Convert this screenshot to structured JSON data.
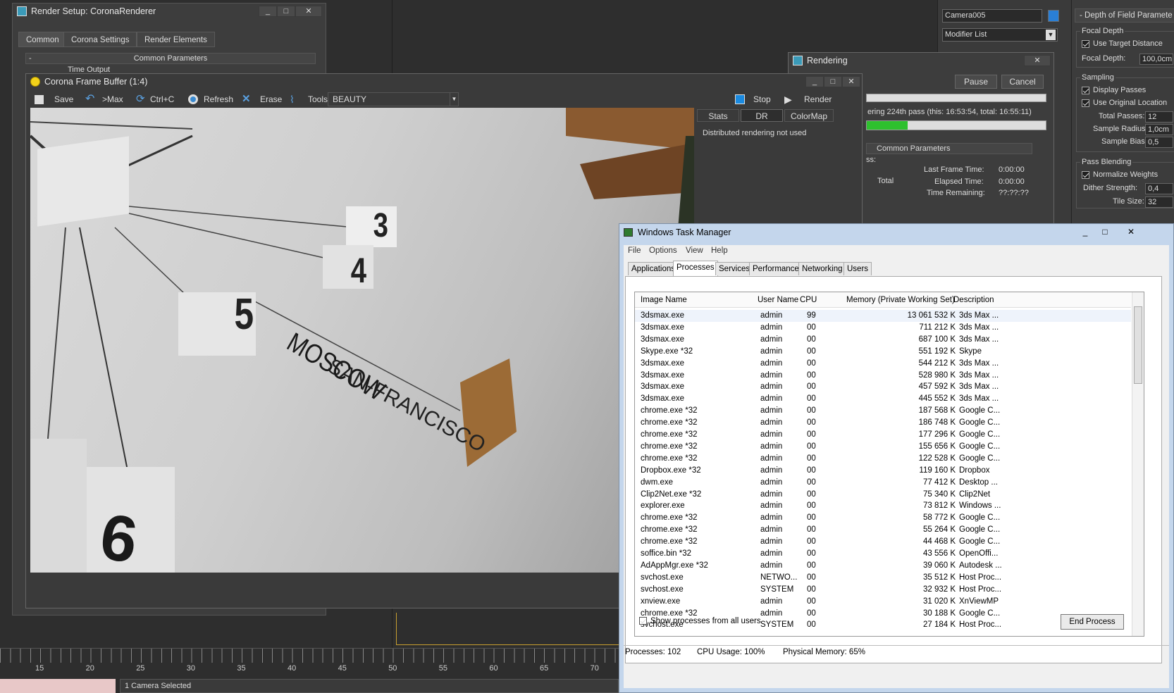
{
  "render_setup": {
    "title": "Render Setup: CoronaRenderer",
    "tabs": [
      "Common",
      "Corona Settings",
      "Render Elements"
    ],
    "rollout": "Common Parameters",
    "group": "Time Output"
  },
  "frame_buffer": {
    "title": "Corona Frame Buffer (1:4)",
    "toolbar": {
      "save": "Save",
      "max": ">Max",
      "copy": "Ctrl+C",
      "refresh": "Refresh",
      "erase": "Erase",
      "tools": "Tools",
      "pass": "BEAUTY",
      "stop": "Stop",
      "render": "Render"
    },
    "side_tabs": [
      "Stats",
      "DR",
      "ColorMap"
    ],
    "side_msg": "Distributed rendering not used",
    "image_text": {
      "n3": "3",
      "n4": "4",
      "n5": "5",
      "n6": "6",
      "city1": "SAN-FRANCISCO",
      "city2": "MOSCOW"
    }
  },
  "rendering": {
    "title": "Rendering",
    "pause": "Pause",
    "cancel": "Cancel",
    "status": "ering 224th pass (this: 16:53:54, total: 16:55:11)",
    "progress": 0.23,
    "rollout": "Common Parameters",
    "label_ss": "ss:",
    "label_total": "Total",
    "last_frame_label": "Last Frame Time:",
    "last_frame_value": "0:00:00",
    "elapsed_label": "Elapsed Time:",
    "elapsed_value": "0:00:00",
    "remaining_label": "Time Remaining:",
    "remaining_value": "??:??:??"
  },
  "modify_panel": {
    "object_name": "Camera005",
    "modifier_list": "Modifier List",
    "object_color": "#2a7fd6"
  },
  "dof": {
    "title": "Depth of Field Paramete",
    "focal_depth_group": "Focal Depth",
    "use_target": "Use Target Distance",
    "focal_depth_label": "Focal Depth:",
    "focal_depth_value": "100,0cm",
    "sampling_group": "Sampling",
    "display_passes": "Display Passes",
    "use_original": "Use Original Location",
    "total_passes_label": "Total Passes:",
    "total_passes_value": "12",
    "sample_radius_label": "Sample Radius:",
    "sample_radius_value": "1,0cm",
    "sample_bias_label": "Sample Bias:",
    "sample_bias_value": "0,5",
    "pass_blending_group": "Pass Blending",
    "normalize": "Normalize Weights",
    "dither_label": "Dither Strength:",
    "dither_value": "0,4",
    "tile_label": "Tile Size:",
    "tile_value": "32"
  },
  "timeline": {
    "ticks": [
      "15",
      "20",
      "25",
      "30",
      "35",
      "40",
      "45",
      "50",
      "55",
      "60",
      "65",
      "70"
    ],
    "status": "1 Camera Selected"
  },
  "task_manager": {
    "title": "Windows Task Manager",
    "menu": [
      "File",
      "Options",
      "View",
      "Help"
    ],
    "tabs": [
      "Applications",
      "Processes",
      "Services",
      "Performance",
      "Networking",
      "Users"
    ],
    "columns": [
      "Image Name",
      "User Name",
      "CPU",
      "Memory (Private Working Set)",
      "Description"
    ],
    "rows": [
      {
        "name": "3dsmax.exe",
        "user": "admin",
        "cpu": "99",
        "mem": "13 061 532 K",
        "desc": "3ds Max ..."
      },
      {
        "name": "3dsmax.exe",
        "user": "admin",
        "cpu": "00",
        "mem": "711 212 K",
        "desc": "3ds Max ..."
      },
      {
        "name": "3dsmax.exe",
        "user": "admin",
        "cpu": "00",
        "mem": "687 100 K",
        "desc": "3ds Max ..."
      },
      {
        "name": "Skype.exe *32",
        "user": "admin",
        "cpu": "00",
        "mem": "551 192 K",
        "desc": "Skype"
      },
      {
        "name": "3dsmax.exe",
        "user": "admin",
        "cpu": "00",
        "mem": "544 212 K",
        "desc": "3ds Max ..."
      },
      {
        "name": "3dsmax.exe",
        "user": "admin",
        "cpu": "00",
        "mem": "528 980 K",
        "desc": "3ds Max ..."
      },
      {
        "name": "3dsmax.exe",
        "user": "admin",
        "cpu": "00",
        "mem": "457 592 K",
        "desc": "3ds Max ..."
      },
      {
        "name": "3dsmax.exe",
        "user": "admin",
        "cpu": "00",
        "mem": "445 552 K",
        "desc": "3ds Max ..."
      },
      {
        "name": "chrome.exe *32",
        "user": "admin",
        "cpu": "00",
        "mem": "187 568 K",
        "desc": "Google C..."
      },
      {
        "name": "chrome.exe *32",
        "user": "admin",
        "cpu": "00",
        "mem": "186 748 K",
        "desc": "Google C..."
      },
      {
        "name": "chrome.exe *32",
        "user": "admin",
        "cpu": "00",
        "mem": "177 296 K",
        "desc": "Google C..."
      },
      {
        "name": "chrome.exe *32",
        "user": "admin",
        "cpu": "00",
        "mem": "155 656 K",
        "desc": "Google C..."
      },
      {
        "name": "chrome.exe *32",
        "user": "admin",
        "cpu": "00",
        "mem": "122 528 K",
        "desc": "Google C..."
      },
      {
        "name": "Dropbox.exe *32",
        "user": "admin",
        "cpu": "00",
        "mem": "119 160 K",
        "desc": "Dropbox"
      },
      {
        "name": "dwm.exe",
        "user": "admin",
        "cpu": "00",
        "mem": "77 412 K",
        "desc": "Desktop ..."
      },
      {
        "name": "Clip2Net.exe *32",
        "user": "admin",
        "cpu": "00",
        "mem": "75 340 K",
        "desc": "Clip2Net"
      },
      {
        "name": "explorer.exe",
        "user": "admin",
        "cpu": "00",
        "mem": "73 812 K",
        "desc": "Windows ..."
      },
      {
        "name": "chrome.exe *32",
        "user": "admin",
        "cpu": "00",
        "mem": "58 772 K",
        "desc": "Google C..."
      },
      {
        "name": "chrome.exe *32",
        "user": "admin",
        "cpu": "00",
        "mem": "55 264 K",
        "desc": "Google C..."
      },
      {
        "name": "chrome.exe *32",
        "user": "admin",
        "cpu": "00",
        "mem": "44 468 K",
        "desc": "Google C..."
      },
      {
        "name": "soffice.bin *32",
        "user": "admin",
        "cpu": "00",
        "mem": "43 556 K",
        "desc": "OpenOffi..."
      },
      {
        "name": "AdAppMgr.exe *32",
        "user": "admin",
        "cpu": "00",
        "mem": "39 060 K",
        "desc": "Autodesk ..."
      },
      {
        "name": "svchost.exe",
        "user": "NETWO...",
        "cpu": "00",
        "mem": "35 512 K",
        "desc": "Host Proc..."
      },
      {
        "name": "svchost.exe",
        "user": "SYSTEM",
        "cpu": "00",
        "mem": "32 932 K",
        "desc": "Host Proc..."
      },
      {
        "name": "xnview.exe",
        "user": "admin",
        "cpu": "00",
        "mem": "31 020 K",
        "desc": "XnViewMP"
      },
      {
        "name": "chrome.exe *32",
        "user": "admin",
        "cpu": "00",
        "mem": "30 188 K",
        "desc": "Google C..."
      },
      {
        "name": "svchost.exe",
        "user": "SYSTEM",
        "cpu": "00",
        "mem": "27 184 K",
        "desc": "Host Proc..."
      }
    ],
    "show_all": "Show processes from all users",
    "end_process": "End Process",
    "status_processes": "Processes: 102",
    "status_cpu": "CPU Usage: 100%",
    "status_memory": "Physical Memory: 65%"
  }
}
